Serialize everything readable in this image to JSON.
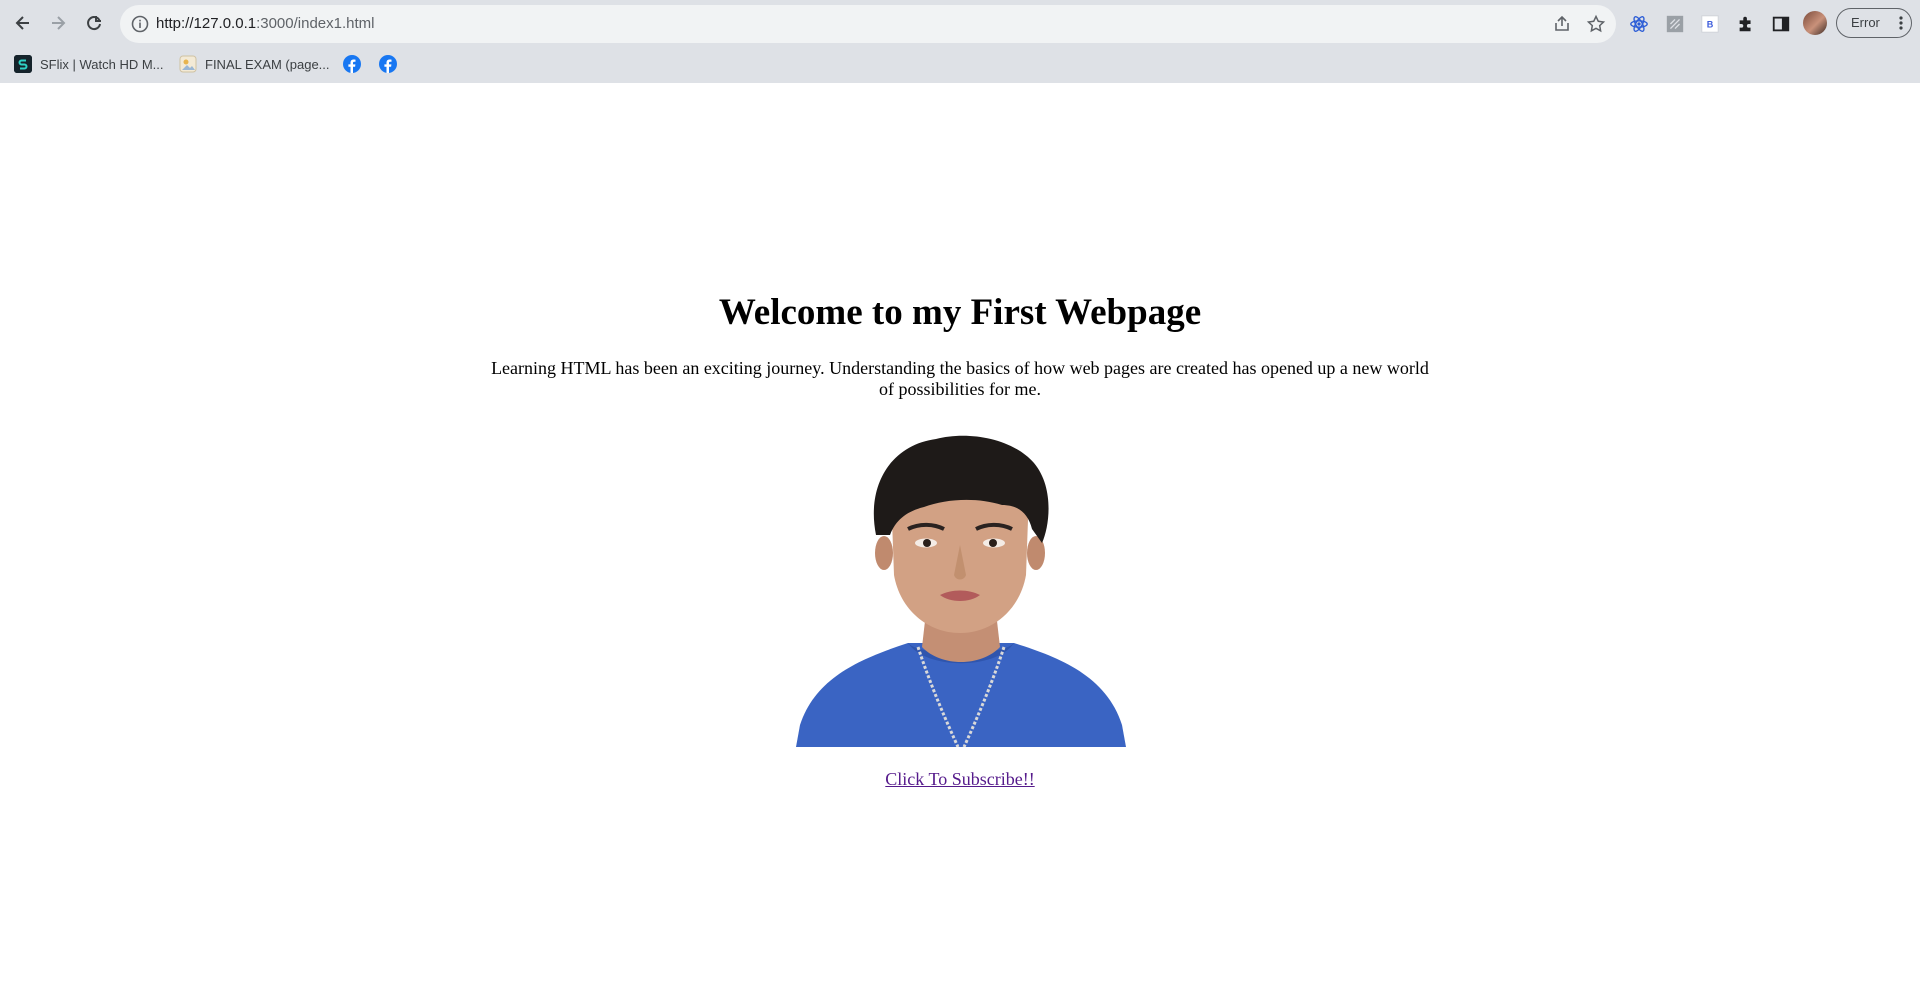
{
  "browser": {
    "url_host": "http://127.0.0.1",
    "url_rest": ":3000/index1.html",
    "profile_button_label": "Error"
  },
  "bookmarks": [
    {
      "label": "SFlix | Watch HD M...",
      "icon": "sflix-favicon"
    },
    {
      "label": "FINAL EXAM (page...",
      "icon": "exam-favicon"
    },
    {
      "label": "",
      "icon": "facebook-icon"
    },
    {
      "label": "",
      "icon": "facebook-icon"
    }
  ],
  "page": {
    "title": "Welcome to my First Webpage",
    "intro": "Learning HTML has been an exciting journey. Understanding the basics of how web pages are created has opened up a new world of possibilities for me.",
    "subscribe_link": "Click To Subscribe!!"
  },
  "colors": {
    "toolbar_bg": "#dee1e6",
    "omnibox_bg": "#f1f3f4",
    "link_visited": "#551a8b",
    "facebook_blue": "#1877f2",
    "shirt_blue": "#3a64c3"
  }
}
